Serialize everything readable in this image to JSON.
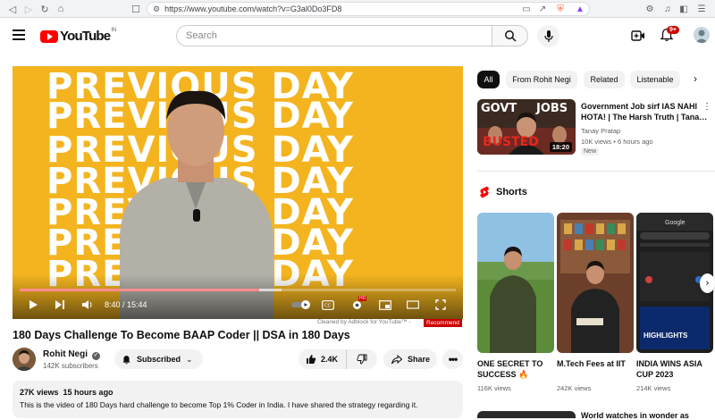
{
  "browser": {
    "url": "https://www.youtube.com/watch?v=G3al0Do3FD8",
    "colors": {
      "bar": "#f1f3f4"
    }
  },
  "header": {
    "logo_text": "YouTube",
    "country_code": "IN",
    "search_placeholder": "Search",
    "notification_count": "9+"
  },
  "player": {
    "background_word": "PREVIOUS DAY",
    "time_display": "8:40 / 15:44",
    "progress_fraction": 0.55,
    "buffered_fraction": 0.6,
    "quality_badge": "HD",
    "adblock_note": "Cleaned by Adblock for YouTube™ -",
    "recommend_label": "Recommend",
    "colors": {
      "background": "#f3b41f",
      "progress": "#ff0000"
    }
  },
  "video": {
    "title": "180 Days Challenge To Become BAAP Coder || DSA in 180 Days",
    "channel_name": "Rohit Negi",
    "subscribers": "142K subscribers",
    "subscribed_label": "Subscribed",
    "like_count": "2.4K",
    "share_label": "Share",
    "views": "27K views",
    "age": "15 hours ago",
    "description": "This is the video of 180 Days hard challenge to become Top 1% Coder in India. I have shared the strategy regarding it."
  },
  "chips": [
    "All",
    "From Rohit Negi",
    "Related",
    "Listenable"
  ],
  "recommendation": {
    "title": "Government Job sirf IAS NAHI HOTA! | The Harsh Truth | Tana…",
    "channel": "Tanay Pratap",
    "meta": "10K views • 6 hours ago",
    "badge": "New",
    "duration": "18:20",
    "thumb_text_left": "GOVT",
    "thumb_text_right": "JOBS",
    "thumb_text_bottom": "BUSTED"
  },
  "shorts": {
    "label": "Shorts",
    "items": [
      {
        "title": "ONE SECRET TO SUCCESS 🔥",
        "views": "116K views"
      },
      {
        "title": "M.Tech Fees at IIT",
        "views": "242K views"
      },
      {
        "title": "INDIA WINS ASIA CUP 2023",
        "views": "214K views"
      }
    ]
  },
  "next_item": {
    "title": "World watches in wonder as"
  }
}
